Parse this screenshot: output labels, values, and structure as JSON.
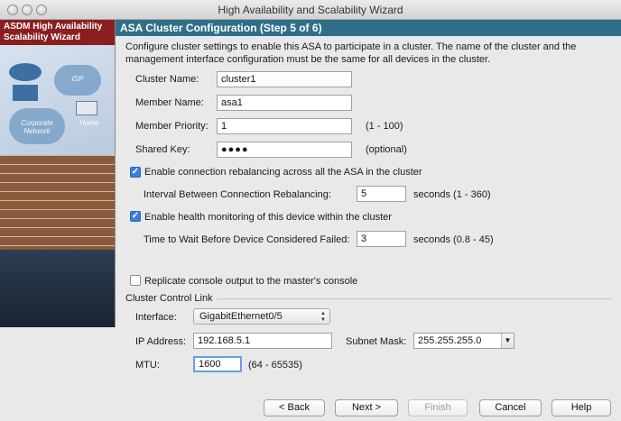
{
  "window": {
    "title": "High Availability and Scalability Wizard"
  },
  "sidebar": {
    "title_line1": "ASDM High Availability",
    "title_line2": "Scalability Wizard",
    "art_labels": {
      "isp": "ISP",
      "home": "Home",
      "corporate_line1": "Corporate",
      "corporate_line2": "Network"
    }
  },
  "header": {
    "title": "ASA Cluster Configuration (Step 5 of 6)"
  },
  "intro": {
    "line1": "Configure cluster settings to enable this ASA to participate in a cluster. The name of the cluster and the",
    "line2": "management interface configuration must be the same for all devices in the cluster."
  },
  "fields": {
    "cluster_name": {
      "label": "Cluster Name:",
      "value": "cluster1"
    },
    "member_name": {
      "label": "Member Name:",
      "value": "asa1"
    },
    "member_priority": {
      "label": "Member Priority:",
      "value": "1",
      "hint": "(1 - 100)"
    },
    "shared_key": {
      "label": "Shared Key:",
      "value": "●●●●",
      "hint": "(optional)"
    }
  },
  "rebalancing": {
    "checked": true,
    "label": "Enable connection rebalancing across all the ASA in the cluster",
    "interval_label": "Interval Between Connection Rebalancing:",
    "interval_value": "5",
    "interval_unit": "seconds (1 - 360)"
  },
  "health": {
    "checked": true,
    "label": "Enable health monitoring of this device within the cluster",
    "wait_label": "Time to Wait Before Device Considered Failed:",
    "wait_value": "3",
    "wait_unit": "seconds (0.8 - 45)"
  },
  "replicate": {
    "checked": false,
    "label": "Replicate console output to the master's console"
  },
  "ccl": {
    "section_title": "Cluster Control Link",
    "interface_label": "Interface:",
    "interface_value": "GigabitEthernet0/5",
    "ip_label": "IP Address:",
    "ip_value": "192.168.5.1",
    "mask_label": "Subnet Mask:",
    "mask_value": "255.255.255.0",
    "mtu_label": "MTU:",
    "mtu_value": "1600",
    "mtu_hint": "(64 - 65535)"
  },
  "buttons": {
    "back": "< Back",
    "next": "Next >",
    "finish": "Finish",
    "cancel": "Cancel",
    "help": "Help"
  },
  "colors": {
    "header_bg": "#2f6f8a",
    "sidebar_head_bg": "#8b1f1f",
    "checkbox_on": "#3b7fd6"
  }
}
